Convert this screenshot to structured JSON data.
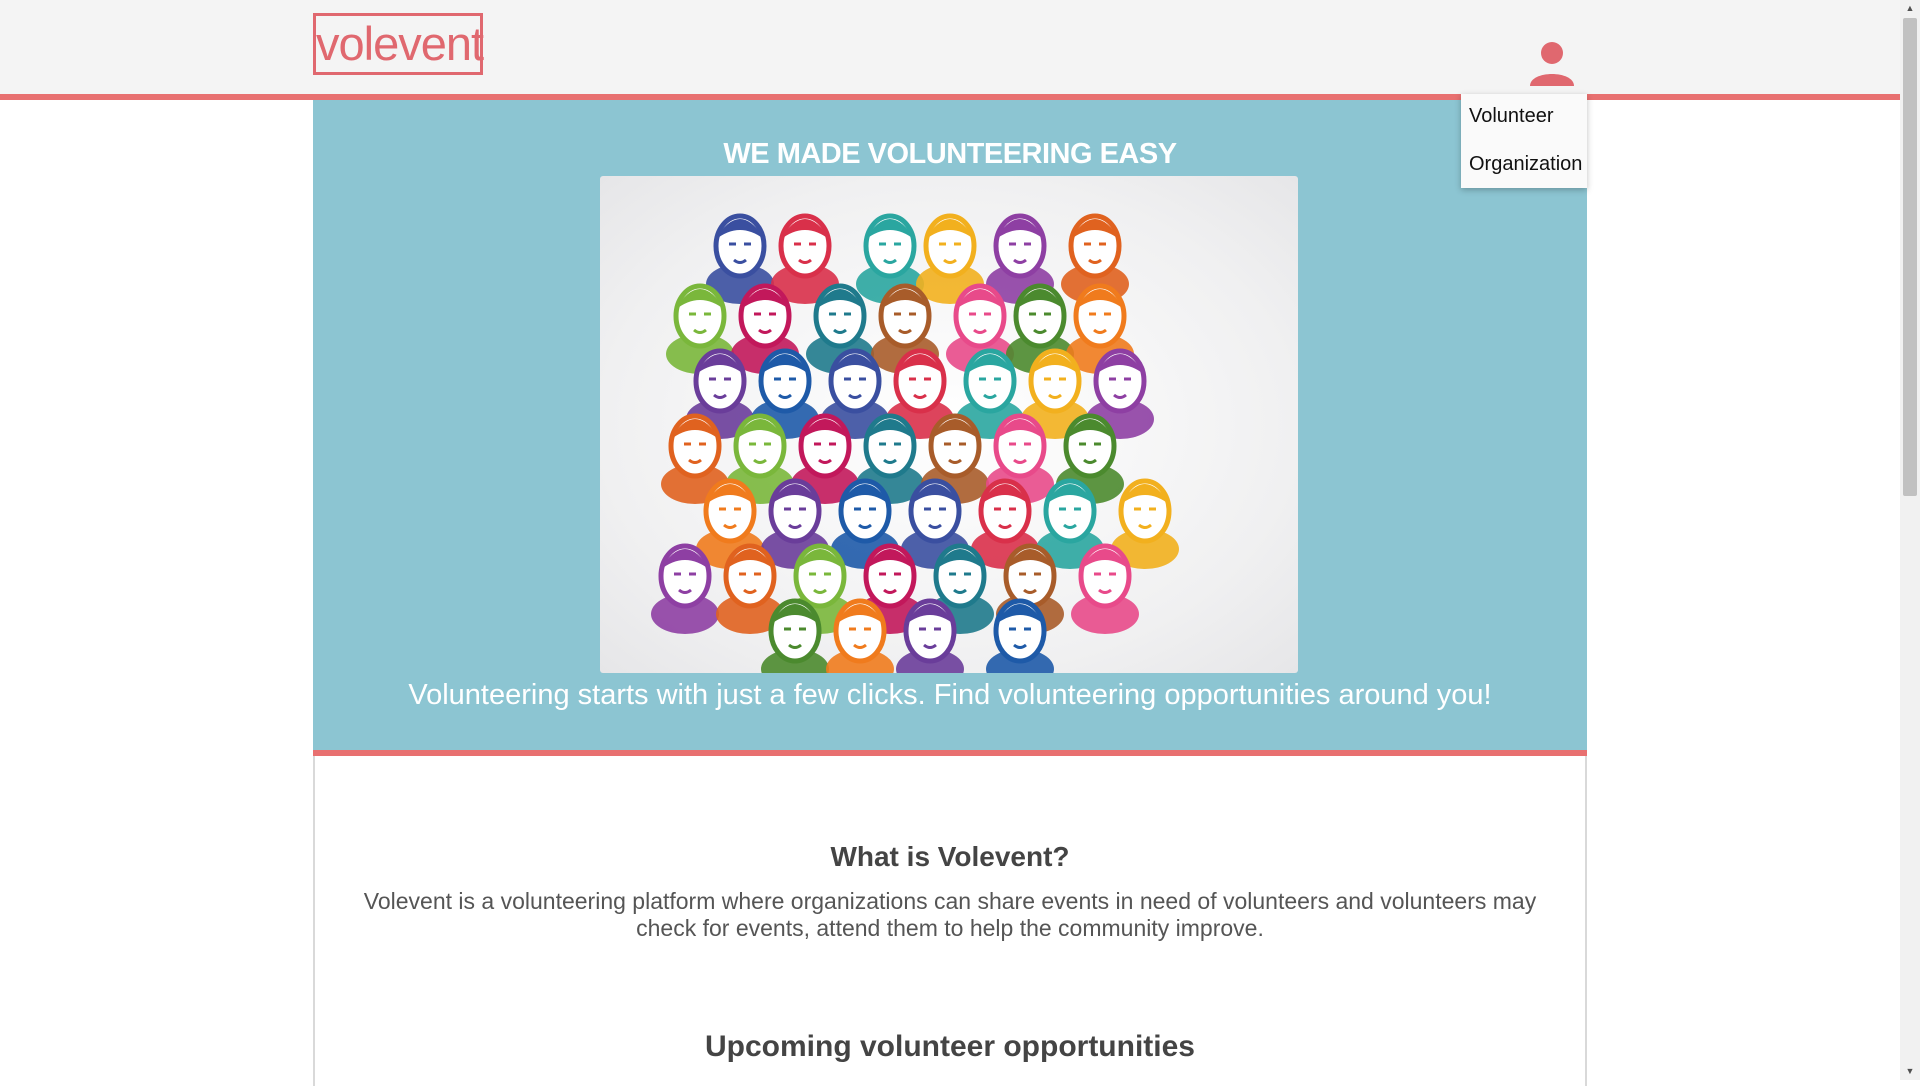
{
  "header": {
    "logo_text": "volevent",
    "account_icon": "user-icon",
    "dropdown": [
      "Volunteer",
      "Organization"
    ]
  },
  "hero": {
    "title": "WE MADE VOLUNTEERING EASY",
    "image_alt": "colorful illustrated crowd of faces",
    "subtitle": "Volunteering starts with just a few clicks. Find volunteering opportunities around you!"
  },
  "about": {
    "title": "What is Volevent?",
    "text": "Volevent is a volunteering platform where organizations can share events in need of volunteers and volunteers may check for events, attend them to help the community improve."
  },
  "upcoming": {
    "title": "Upcoming volunteer opportunities"
  },
  "colors": {
    "accent": "#e87070",
    "hero_bg": "#8cc5d2",
    "logo": "#e0686f"
  }
}
